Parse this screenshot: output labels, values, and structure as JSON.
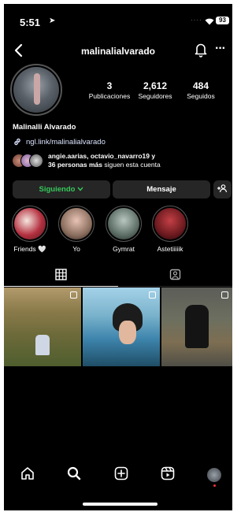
{
  "status_bar": {
    "time": "5:51",
    "signal": "····",
    "battery": "93"
  },
  "header": {
    "username": "malinalialvarado"
  },
  "profile": {
    "full_name": "Malinalli Alvarado",
    "link": "ngl.link/malinalialvarado",
    "stats": [
      {
        "value": "3",
        "label": "Publicaciones"
      },
      {
        "value": "2,612",
        "label": "Seguidores"
      },
      {
        "value": "484",
        "label": "Seguidos"
      }
    ],
    "followed_by": {
      "line1": "angie.aarias, octavio_navarro19 y",
      "count_bold": "36 personas más",
      "suffix": "siguen esta cuenta"
    }
  },
  "actions": {
    "following_label": "Siguiendo",
    "message_label": "Mensaje"
  },
  "highlights": [
    {
      "label": "Friends 🤍"
    },
    {
      "label": "Yo"
    },
    {
      "label": "Gymrat"
    },
    {
      "label": "Astetiiiiik"
    }
  ],
  "colors": {
    "background": "#000000",
    "button": "#262626",
    "following_green": "#35c759",
    "notification_dot": "#ff3040"
  },
  "icons": {
    "back": "chevron-left-icon",
    "bell": "bell-icon",
    "more": "more-icon",
    "link": "link-icon",
    "add_person": "add-person-icon",
    "grid": "grid-icon",
    "tagged": "tagged-icon",
    "home": "home-icon",
    "search": "search-icon",
    "create": "create-icon",
    "reels": "reels-icon"
  }
}
